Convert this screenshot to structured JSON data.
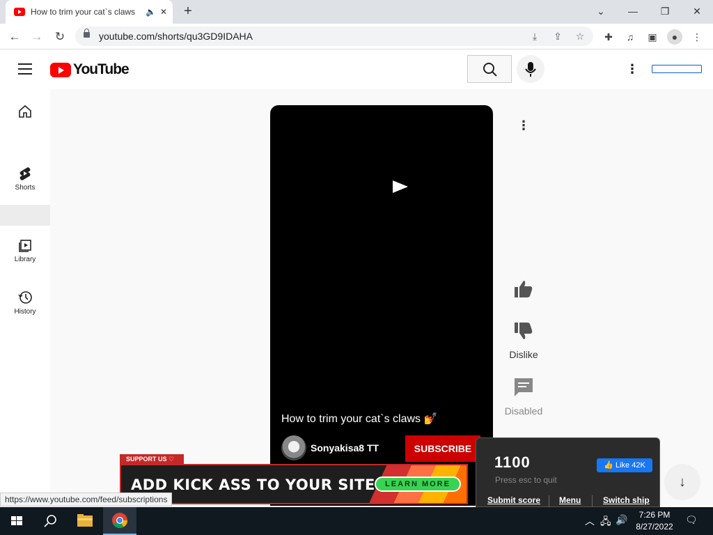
{
  "browser": {
    "tab_title": "How to trim your cat`s claws",
    "new_tab": "+",
    "url": "youtube.com/shorts/qu3GD9IDAHA",
    "window_controls": [
      "chevron-down",
      "minimize",
      "restore",
      "close"
    ]
  },
  "youtube": {
    "logo_text": "YouTube",
    "nav": [
      {
        "label": "",
        "icon": "home-icon"
      },
      {
        "label": "Shorts",
        "icon": "shorts-icon"
      },
      {
        "label": "Library",
        "icon": "library-icon"
      },
      {
        "label": "History",
        "icon": "history-icon"
      }
    ]
  },
  "video": {
    "title": "How to trim your cat`s claws 💅",
    "channel": "Sonyakisa8 TT",
    "subscribe": "SUBSCRIBE",
    "actions": {
      "dislike": "Dislike",
      "comments": "Disabled"
    }
  },
  "ad": {
    "badge": "SUPPORT US ♡",
    "headline": "ADD KICK ASS TO YOUR SITE",
    "cta": "LEARN MORE"
  },
  "game": {
    "score": "1100",
    "hint": "Press esc to quit",
    "fb_like": "👍 Like 42K",
    "links": [
      "Submit score",
      "Menu",
      "Switch ship"
    ]
  },
  "status_url": "https://www.youtube.com/feed/subscriptions",
  "taskbar": {
    "time": "7:26 PM",
    "date": "8/27/2022"
  },
  "colors": {
    "youtube_red": "#ff0000",
    "subscribe_red": "#cc0000",
    "fb_blue": "#1877f2"
  }
}
